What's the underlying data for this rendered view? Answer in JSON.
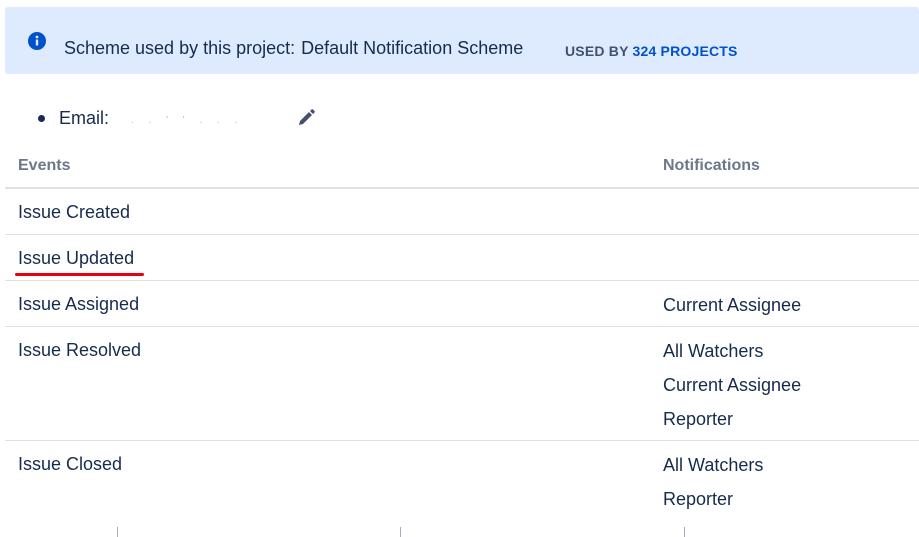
{
  "banner": {
    "icon": "info-icon",
    "lead": "Scheme used by this project:",
    "scheme_name": "Default Notification Scheme",
    "used_by_prefix": "USED BY",
    "used_by_link": "324 PROJECTS",
    "color": "#deebff"
  },
  "email": {
    "label": "Email:",
    "value_redacted": ".  .      '    '      .   .   .",
    "edit_icon": "pencil-icon"
  },
  "table": {
    "headers": {
      "events": "Events",
      "notifications": "Notifications"
    },
    "rows": [
      {
        "event": "Issue Created",
        "recipients": []
      },
      {
        "event": "Issue Updated",
        "recipients": []
      },
      {
        "event": "Issue Assigned",
        "recipients": [
          "Current Assignee"
        ]
      },
      {
        "event": "Issue Resolved",
        "recipients": [
          "All Watchers",
          "Current Assignee",
          "Reporter"
        ]
      },
      {
        "event": "Issue Closed",
        "recipients": [
          "All Watchers",
          "Reporter"
        ]
      }
    ]
  },
  "annotation": {
    "color": "#e60012"
  }
}
